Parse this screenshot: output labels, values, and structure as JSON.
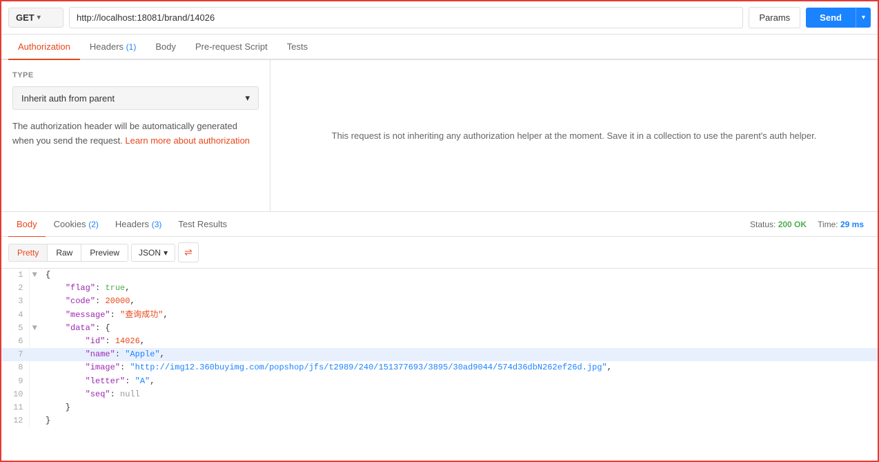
{
  "topBar": {
    "method": "GET",
    "url": "http://localhost:18081/brand/14026",
    "paramsLabel": "Params",
    "sendLabel": "Send"
  },
  "requestTabs": [
    {
      "id": "authorization",
      "label": "Authorization",
      "badge": null,
      "active": true
    },
    {
      "id": "headers",
      "label": "Headers",
      "badge": "1",
      "active": false
    },
    {
      "id": "body",
      "label": "Body",
      "badge": null,
      "active": false
    },
    {
      "id": "prerequest",
      "label": "Pre-request Script",
      "badge": null,
      "active": false
    },
    {
      "id": "tests",
      "label": "Tests",
      "badge": null,
      "active": false
    }
  ],
  "auth": {
    "typeLabel": "TYPE",
    "selectedType": "Inherit auth from parent",
    "descriptionText": "The authorization header will be automatically generated when you send the request.",
    "learnLinkText": "Learn more about authorization",
    "rightPanelText": "This request is not inheriting any authorization helper at the moment. Save it in a collection to use the parent's auth helper."
  },
  "responseTabs": [
    {
      "id": "body",
      "label": "Body",
      "active": true
    },
    {
      "id": "cookies",
      "label": "Cookies",
      "badge": "2",
      "active": false
    },
    {
      "id": "headers",
      "label": "Headers",
      "badge": "3",
      "active": false
    },
    {
      "id": "testresults",
      "label": "Test Results",
      "active": false
    }
  ],
  "responseStatus": {
    "statusLabel": "Status:",
    "statusValue": "200 OK",
    "timeLabel": "Time:",
    "timeValue": "29 ms"
  },
  "formatTabs": [
    {
      "id": "pretty",
      "label": "Pretty",
      "active": true
    },
    {
      "id": "raw",
      "label": "Raw",
      "active": false
    },
    {
      "id": "preview",
      "label": "Preview",
      "active": false
    }
  ],
  "formatType": "JSON",
  "codeLines": [
    {
      "num": 1,
      "expand": "▼",
      "content": "{",
      "highlighted": false
    },
    {
      "num": 2,
      "expand": "",
      "content": "    \"flag\": true,",
      "highlighted": false
    },
    {
      "num": 3,
      "expand": "",
      "content": "    \"code\": 20000,",
      "highlighted": false
    },
    {
      "num": 4,
      "expand": "",
      "content": "    \"message\": \"查询成功\",",
      "highlighted": false
    },
    {
      "num": 5,
      "expand": "▼",
      "content": "    \"data\": {",
      "highlighted": false
    },
    {
      "num": 6,
      "expand": "",
      "content": "        \"id\": 14026,",
      "highlighted": false
    },
    {
      "num": 7,
      "expand": "",
      "content": "        \"name\": \"Apple\",",
      "highlighted": true
    },
    {
      "num": 8,
      "expand": "",
      "content": "        \"image\": \"http://img12.360buyimg.com/popshop/jfs/t2989/240/151377693/3895/30ad9044/574d36dbN262ef26d.jpg\",",
      "highlighted": false
    },
    {
      "num": 9,
      "expand": "",
      "content": "        \"letter\": \"A\",",
      "highlighted": false
    },
    {
      "num": 10,
      "expand": "",
      "content": "        \"seq\": null",
      "highlighted": false
    },
    {
      "num": 11,
      "expand": "",
      "content": "    }",
      "highlighted": false
    },
    {
      "num": 12,
      "expand": "",
      "content": "}",
      "highlighted": false
    }
  ]
}
